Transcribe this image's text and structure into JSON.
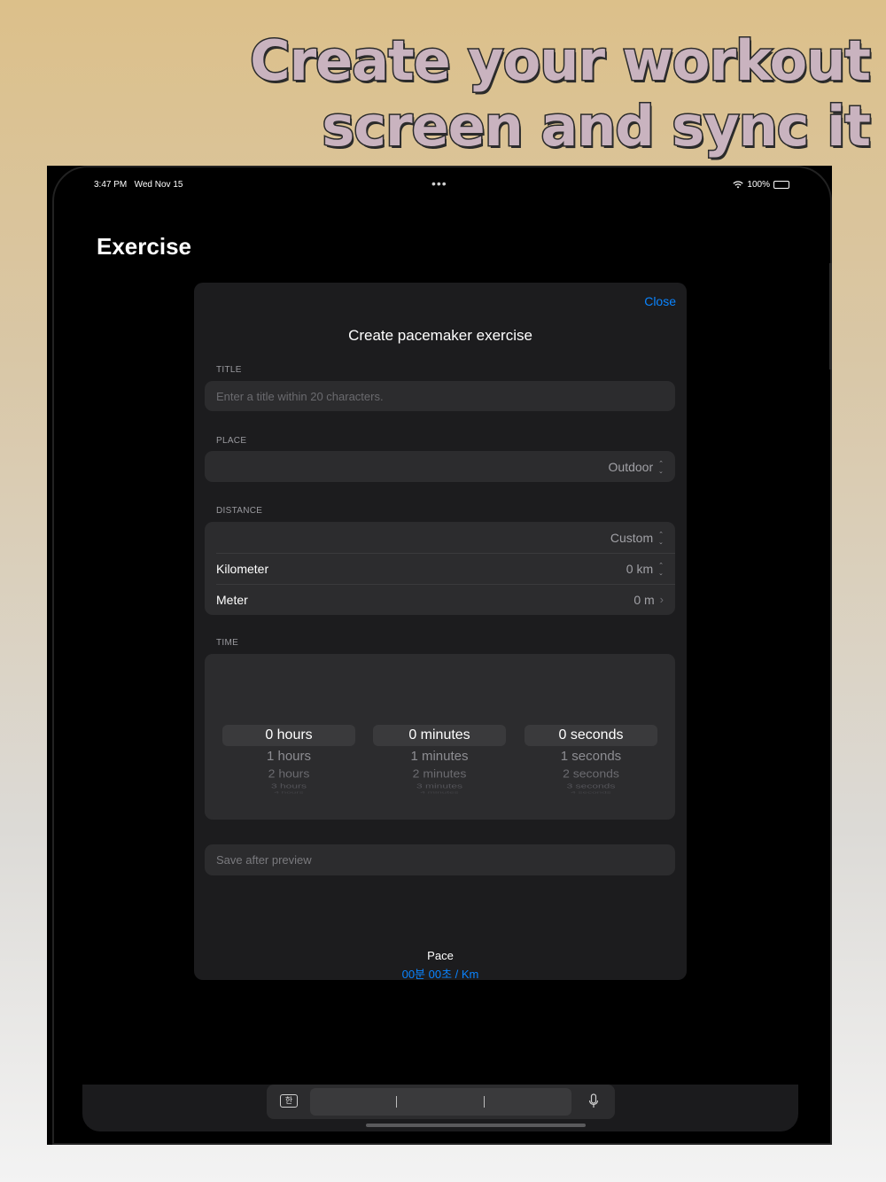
{
  "headline": {
    "line1": "Create your workout",
    "line2": "screen and sync it"
  },
  "status": {
    "time": "3:47 PM",
    "date": "Wed Nov 15",
    "battery": "100%"
  },
  "page_title": "Exercise",
  "sheet": {
    "close_label": "Close",
    "title": "Create pacemaker exercise",
    "title_section": {
      "label": "TITLE",
      "placeholder": "Enter a title within 20 characters."
    },
    "place_section": {
      "label": "PLACE",
      "value": "Outdoor"
    },
    "distance_section": {
      "label": "DISTANCE",
      "preset_value": "Custom",
      "rows": [
        {
          "label": "Kilometer",
          "value": "0 km"
        },
        {
          "label": "Meter",
          "value": "0 m"
        }
      ]
    },
    "time_section": {
      "label": "TIME",
      "wheels": [
        {
          "selected": "0 hours",
          "opts": [
            "1 hours",
            "2 hours",
            "3 hours",
            "4 hours"
          ]
        },
        {
          "selected": "0 minutes",
          "opts": [
            "1 minutes",
            "2 minutes",
            "3 minutes",
            "4 minutes"
          ]
        },
        {
          "selected": "0 seconds",
          "opts": [
            "1 seconds",
            "2 seconds",
            "3 seconds",
            "4 seconds"
          ]
        }
      ]
    },
    "save_placeholder": "Save after preview",
    "pace": {
      "label": "Pace",
      "value": "00분 00초  / Km"
    }
  },
  "keyboard": {
    "lang_key": "한"
  },
  "colors": {
    "accent": "#0a84ff",
    "sheet_bg": "#1c1c1e",
    "field_bg": "#2c2c2e"
  }
}
